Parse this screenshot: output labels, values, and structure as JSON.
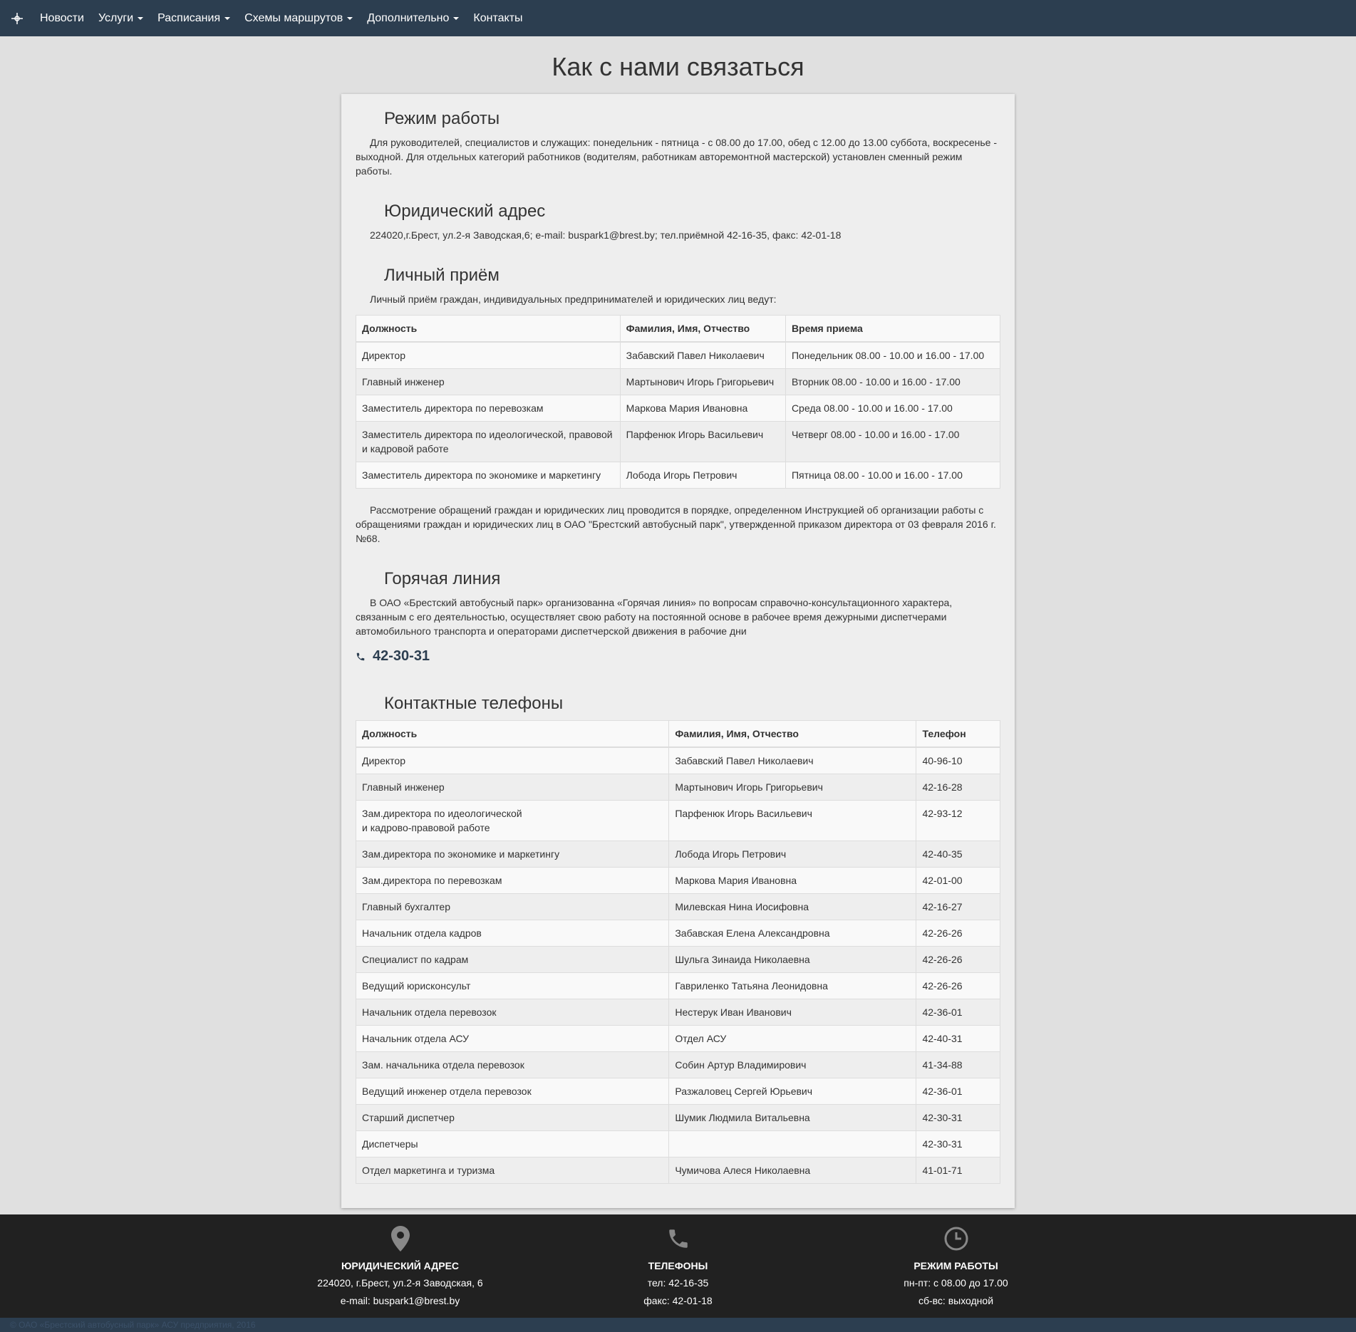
{
  "nav": {
    "items": [
      {
        "label": "Новости",
        "dropdown": false
      },
      {
        "label": "Услуги",
        "dropdown": true
      },
      {
        "label": "Расписания",
        "dropdown": true
      },
      {
        "label": "Схемы маршрутов",
        "dropdown": true
      },
      {
        "label": "Дополнительно",
        "dropdown": true
      },
      {
        "label": "Контакты",
        "dropdown": false
      }
    ]
  },
  "page_title": "Как с нами связаться",
  "work_mode": {
    "heading": "Режим работы",
    "text": "Для руководителей, специалистов и служащих: понедельник - пятница - с 08.00 до 17.00, обед с 12.00 до 13.00 суббота, воскресенье - выходной. Для отдельных категорий работников (водителям, работникам авторемонтной мастерской) установлен сменный режим работы."
  },
  "legal_address": {
    "heading": "Юридический адрес",
    "text": "224020,г.Брест, ул.2-я Заводская,6; e-mail: buspark1@brest.by; тел.приёмной 42-16-35, факс: 42-01-18"
  },
  "reception": {
    "heading": "Личный приём",
    "intro": "Личный приём граждан, индивидуальных предпринимателей и юридических лиц ведут:",
    "columns": [
      "Должность",
      "Фамилия, Имя, Отчество",
      "Время приема"
    ],
    "rows": [
      [
        "Директор",
        "Забавский Павел Николаевич",
        "Понедельник 08.00 - 10.00 и 16.00 - 17.00"
      ],
      [
        "Главный инженер",
        "Мартынович Игорь Григорьевич",
        "Вторник 08.00 - 10.00 и 16.00 - 17.00"
      ],
      [
        "Заместитель директора по перевозкам",
        "Маркова Мария Ивановна",
        "Среда 08.00 - 10.00 и 16.00 - 17.00"
      ],
      [
        "Заместитель директора по идеологической, правовой и кадровой работе",
        "Парфенюк Игорь Васильевич",
        "Четверг 08.00 - 10.00 и 16.00 - 17.00"
      ],
      [
        "Заместитель директора по экономике и маркетингу",
        "Лобода Игорь Петрович",
        "Пятница 08.00 - 10.00 и 16.00 - 17.00"
      ]
    ],
    "note": "Рассмотрение обращений граждан и юридических лиц проводится в порядке, определенном Инструкцией об организации работы с обращениями граждан и юридических лиц в ОАО \"Брестский автобусный парк\", утвержденной приказом директора от 03 февраля 2016 г. №68."
  },
  "hotline": {
    "heading": "Горячая линия",
    "text": "В ОАО «Брестский автобусный парк» организованна «Горячая линия» по вопросам справочно-консультационного характера, связанным с его деятельностью, осуществляет свою работу на постоянной основе в рабочее время дежурными диспетчерами автомобильного транспорта и операторами диспетчерской движения в рабочие дни",
    "phone": "42-30-31"
  },
  "contacts": {
    "heading": "Контактные телефоны",
    "columns": [
      "Должность",
      "Фамилия, Имя, Отчество",
      "Телефон"
    ],
    "rows": [
      [
        "Директор",
        "Забавский Павел Николаевич",
        "40-96-10"
      ],
      [
        "Главный инженер",
        "Мартынович Игорь Григорьевич",
        "42-16-28"
      ],
      [
        "Зам.директора по идеологической\nи кадрово-правовой работе",
        "Парфенюк Игорь Васильевич",
        "42-93-12"
      ],
      [
        "Зам.директора по экономике и маркетингу",
        "Лобода Игорь Петрович",
        "42-40-35"
      ],
      [
        "Зам.директора по перевозкам",
        "Маркова Мария Ивановна",
        "42-01-00"
      ],
      [
        "Главный бухгалтер",
        "Милевская Нина Иосифовна",
        "42-16-27"
      ],
      [
        "Начальник отдела кадров",
        "Забавская Елена Александровна",
        "42-26-26"
      ],
      [
        "Специалист по кадрам",
        "Шульга Зинаида Николаевна",
        "42-26-26"
      ],
      [
        "Ведущий юрисконсульт",
        "Гавриленко Татьяна Леонидовна",
        "42-26-26"
      ],
      [
        "Начальник отдела перевозок",
        "Нестерук Иван Иванович",
        "42-36-01"
      ],
      [
        "Начальник отдела АСУ",
        "Отдел АСУ",
        "42-40-31"
      ],
      [
        "Зам. начальника отдела перевозок",
        "Собин Артур Владимирович",
        "41-34-88"
      ],
      [
        "Ведущий инженер отдела перевозок",
        "Разжаловец Сергей Юрьевич",
        "42-36-01"
      ],
      [
        "Старший диспетчер",
        "Шумик Людмила Витальевна",
        "42-30-31"
      ],
      [
        "Диспетчеры",
        "",
        "42-30-31"
      ],
      [
        "Отдел маркетинга и туризма",
        "Чумичова Алеся Николаевна",
        "41-01-71"
      ]
    ]
  },
  "footer": {
    "address": {
      "icon": "map-marker-icon",
      "title": "Юридический адрес",
      "line1": "224020, г.Брест, ул.2-я Заводская, 6",
      "line2": "e-mail: buspark1@brest.by"
    },
    "phones": {
      "icon": "phone-icon",
      "title": "Телефоны",
      "line1": "тел: 42-16-35",
      "line2": "факс: 42-01-18"
    },
    "hours": {
      "icon": "clock-icon",
      "title": "Режим работы",
      "line1": "пн-пт: с 08.00 до 17.00",
      "line2": "сб-вс: выходной"
    }
  },
  "copyright": "© ОАО «Брестский автобусный парк» АСУ предприятия, 2016",
  "colors": {
    "navbar": "#2c3e50",
    "footer": "#212121",
    "page_bg": "#e0e0e0",
    "card_bg": "#eeeeee",
    "accent": "#2c3e50"
  }
}
